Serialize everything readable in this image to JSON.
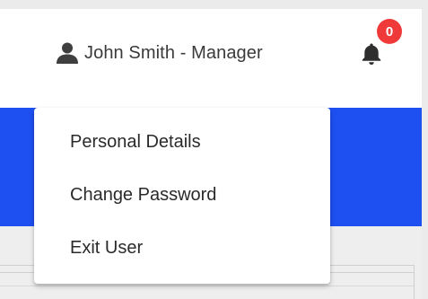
{
  "header": {
    "user_label": "John Smith - Manager",
    "notifications_count": "0"
  },
  "dropdown": {
    "items": [
      {
        "label": "Personal Details"
      },
      {
        "label": "Change Password"
      },
      {
        "label": "Exit User"
      }
    ]
  },
  "icons": {
    "user": "user-icon",
    "notifications": "bell-icon"
  },
  "colors": {
    "accent_band": "#1e4ff0",
    "badge": "#f03a3a",
    "text": "#2a2a2a"
  }
}
